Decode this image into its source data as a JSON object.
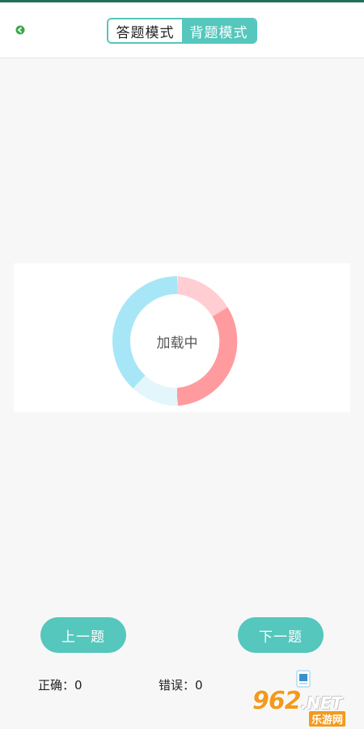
{
  "header": {
    "back_icon": "back-arrow-icon",
    "modes": [
      {
        "label": "答题模式",
        "active": false
      },
      {
        "label": "背题模式",
        "active": true
      }
    ]
  },
  "loader": {
    "text": "加载中",
    "colors": {
      "blue": "#a7e6f6",
      "light_blue": "#e3f6fb",
      "pink": "#ff9b9f",
      "light_pink": "#ffcdd2"
    }
  },
  "nav": {
    "prev_label": "上一题",
    "next_label": "下一题"
  },
  "stats": {
    "correct": "正确：0",
    "wrong": "错误：0"
  },
  "answer_sheet_icon": "answer-sheet-icon",
  "watermark": {
    "brand": "962",
    "suffix": ".NET",
    "sub": "乐游网"
  },
  "colors": {
    "accent": "#55c7bd",
    "background": "#f7f7f7"
  }
}
